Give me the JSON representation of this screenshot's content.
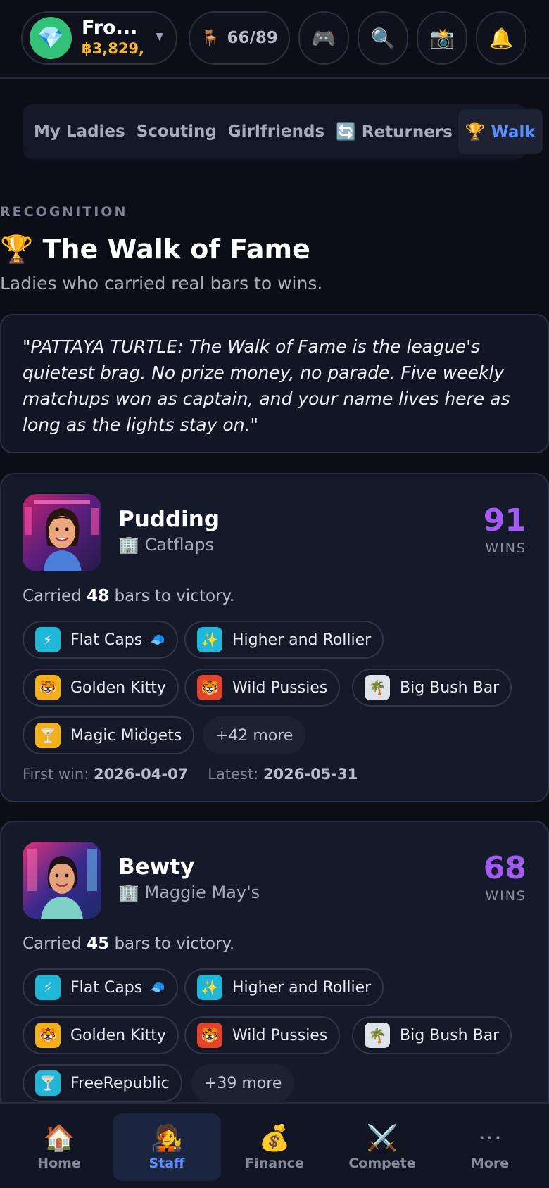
{
  "header": {
    "profile_icon": "gem-icon",
    "profile_name": "Fro...",
    "profile_money": "฿3,829,",
    "seats_icon": "chair-icon",
    "seats": "66/89",
    "buttons": [
      {
        "icon": "gamepad-icon",
        "glyph": "🎮"
      },
      {
        "icon": "search-icon",
        "glyph": "🔍"
      },
      {
        "icon": "camera-icon",
        "glyph": "📸"
      },
      {
        "icon": "bell-icon",
        "glyph": "🔔"
      }
    ]
  },
  "tabs": {
    "my_ladies": "My Ladies",
    "scouting": "Scouting",
    "girlfriends": "Girlfriends",
    "returners": "🔄 Returners",
    "walk": "🏆 Walk"
  },
  "section": {
    "eyebrow": "RECOGNITION",
    "title": "🏆 The Walk of Fame",
    "subtitle": "Ladies who carried real bars to wins.",
    "quote": "\"PATTAYA TURTLE: The Walk of Fame is the league's quietest brag. No prize money, no parade. Five weekly matchups won as captain, and your name lives here as long as the lights stay on.\""
  },
  "cards": [
    {
      "name": "Pudding",
      "venue": "🏢 Catflaps",
      "wins": "91",
      "wins_label": "WINS",
      "carried_pre": "Carried ",
      "carried_num": "48",
      "carried_post": " bars to victory.",
      "bars": [
        {
          "label": "Flat Caps",
          "badge": "⚡",
          "tail": "🧢",
          "color": "#1fb6d8"
        },
        {
          "label": "Higher and Rollier",
          "badge": "✨",
          "color": "#1fb6d8"
        },
        {
          "label": "Golden Kitty",
          "badge": "🐯",
          "color": "#f2b01d"
        },
        {
          "label": "Wild Pussies",
          "badge": "🐯",
          "color": "#e0462e"
        },
        {
          "label": "Big Bush Bar",
          "badge": "🌴",
          "color": "#dfe3ec"
        },
        {
          "label": "Magic Midgets",
          "badge": "🍸",
          "color": "#f2b01d"
        }
      ],
      "more": "+42 more",
      "first_label": "First win: ",
      "first_date": "2026-04-07",
      "latest_label": "Latest: ",
      "latest_date": "2026-05-31"
    },
    {
      "name": "Bewty",
      "venue": "🏢 Maggie May's",
      "wins": "68",
      "wins_label": "WINS",
      "carried_pre": "Carried ",
      "carried_num": "45",
      "carried_post": " bars to victory.",
      "bars": [
        {
          "label": "Flat Caps",
          "badge": "⚡",
          "tail": "🧢",
          "color": "#1fb6d8"
        },
        {
          "label": "Higher and Rollier",
          "badge": "✨",
          "color": "#1fb6d8"
        },
        {
          "label": "Golden Kitty",
          "badge": "🐯",
          "color": "#f2b01d"
        },
        {
          "label": "Wild Pussies",
          "badge": "🐯",
          "color": "#e0462e"
        },
        {
          "label": "Big Bush Bar",
          "badge": "🌴",
          "color": "#dfe3ec"
        },
        {
          "label": "FreeRepublic",
          "badge": "🍸",
          "color": "#1fb6d8"
        }
      ],
      "more": "+39 more"
    }
  ],
  "nav": [
    {
      "label": "Home",
      "icon": "home-icon",
      "glyph": "🏠"
    },
    {
      "label": "Staff",
      "icon": "staff-icon",
      "glyph": "🧑‍🎤",
      "active": true
    },
    {
      "label": "Finance",
      "icon": "money-bag-icon",
      "glyph": "💰"
    },
    {
      "label": "Compete",
      "icon": "crossed-swords-icon",
      "glyph": "⚔️"
    },
    {
      "label": "More",
      "icon": "more-icon",
      "glyph": "···"
    }
  ]
}
